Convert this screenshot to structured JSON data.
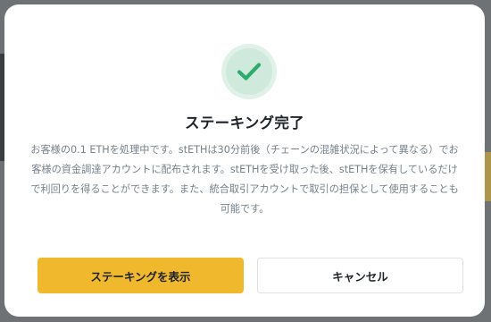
{
  "dialog": {
    "title": "ステーキング完了",
    "message": "お客様の0.1 ETHを処理中です。stETHは30分前後（チェーンの混雑状況によって異なる）でお客様の資金調達アカウントに配布されます。stETHを受け取った後、stETHを保有しているだけで利回りを得ることができます。また、統合取引アカウントで取引の担保として使用することも可能です。",
    "primary_button_label": "ステーキングを表示",
    "secondary_button_label": "キャンセル",
    "icon": "check-icon"
  },
  "colors": {
    "accent": "#f0b92d",
    "success": "#2eaa6b",
    "success_bg": "#dff1e8",
    "text_primary": "#1e2329",
    "text_secondary": "#76808a",
    "overlay": "#6f7275"
  }
}
